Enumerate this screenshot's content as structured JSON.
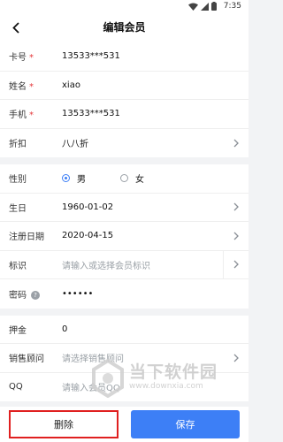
{
  "statusbar": {
    "time": "7:35"
  },
  "header": {
    "title": "编辑会员"
  },
  "group1": [
    {
      "label": "卡号",
      "required": "*",
      "value": "13533***531"
    },
    {
      "label": "姓名",
      "required": "*",
      "value": "xiao"
    },
    {
      "label": "手机",
      "required": "*",
      "value": "13533***531"
    },
    {
      "label": "折扣",
      "value": "八八折"
    }
  ],
  "group2": {
    "gender": {
      "label": "性别",
      "male": "男",
      "female": "女",
      "selected": "男"
    },
    "birthday": {
      "label": "生日",
      "value": "1960-01-02"
    },
    "register": {
      "label": "注册日期",
      "value": "2020-04-15"
    },
    "tag": {
      "label": "标识",
      "placeholder": "请输入或选择会员标识"
    },
    "password": {
      "label": "密码",
      "value": "••••••"
    }
  },
  "group3": {
    "deposit": {
      "label": "押金",
      "value": "0"
    },
    "advisor": {
      "label": "销售顾问",
      "placeholder": "请选择销售顾问"
    },
    "qq": {
      "label": "QQ",
      "placeholder": "请输入会员QQ"
    }
  },
  "buttons": {
    "delete": "删除",
    "save": "保存"
  },
  "watermark": {
    "text": "当下软件园",
    "url": "www.downxia.com"
  },
  "colors": {
    "accent": "#3d7ff6",
    "required": "#e5383b",
    "highlight": "#e02020"
  }
}
